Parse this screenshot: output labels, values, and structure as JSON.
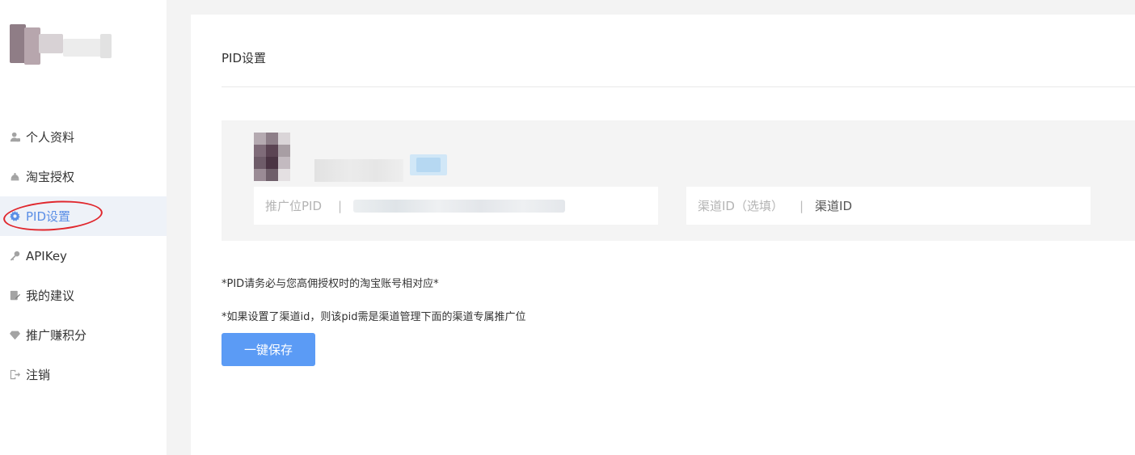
{
  "sidebar": {
    "items": [
      {
        "label": "个人资料",
        "icon": "user-icon"
      },
      {
        "label": "淘宝授权",
        "icon": "taobao-icon"
      },
      {
        "label": "PID设置",
        "icon": "gear-icon",
        "active": true
      },
      {
        "label": "APIKey",
        "icon": "key-icon"
      },
      {
        "label": "我的建议",
        "icon": "edit-icon"
      },
      {
        "label": "推广赚积分",
        "icon": "diamond-icon"
      },
      {
        "label": "注销",
        "icon": "logout-icon"
      }
    ]
  },
  "main": {
    "title": "PID设置",
    "pid_field": {
      "label": "推广位PID",
      "separator": "|"
    },
    "channel_field": {
      "label": "渠道ID（选填）",
      "separator": "|",
      "placeholder": "渠道ID"
    },
    "notes": [
      "*PID请务必与您高佣授权时的淘宝账号相对应*",
      "*如果设置了渠道id，则该pid需是渠道管理下面的渠道专属推广位"
    ],
    "save_label": "一键保存"
  },
  "colors": {
    "accent": "#5a8ee6",
    "button": "#5b9bf5",
    "annotation": "#e0272d",
    "page_bg": "#f3f3f3"
  }
}
